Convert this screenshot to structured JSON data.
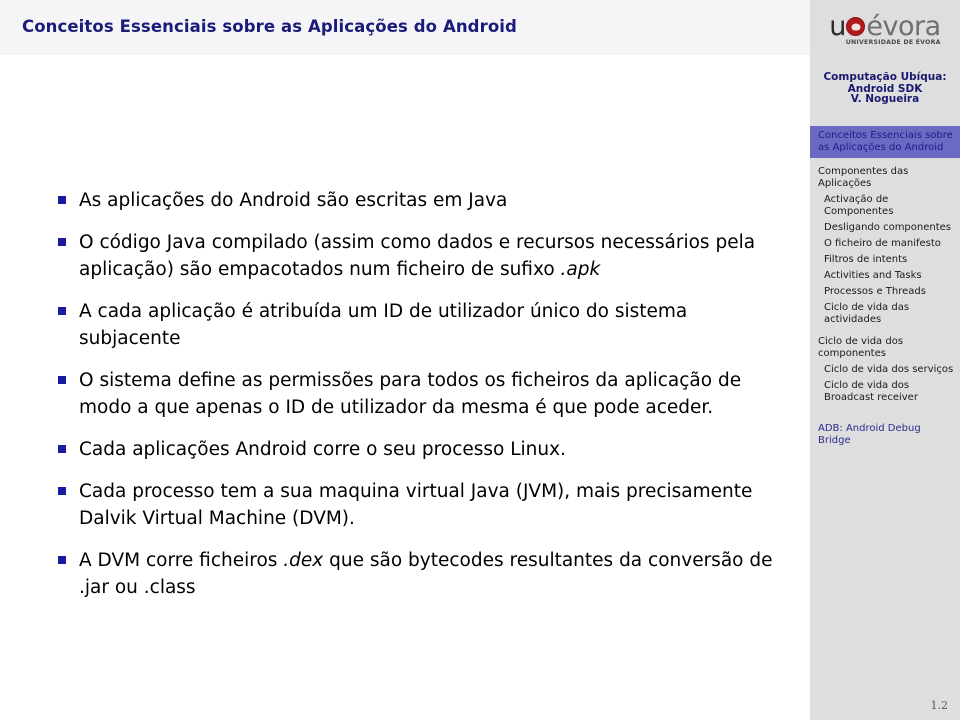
{
  "header": {
    "title": "Conceitos Essenciais sobre as Aplicações do Android"
  },
  "logo": {
    "u": "u",
    "seal": "evora-seal-icon",
    "wordmark": "évora",
    "subtitle": "UNIVERSIDADE DE ÉVORA"
  },
  "sidebar": {
    "course": {
      "line1": "Computação Ubíqua:",
      "line2": "Android SDK",
      "author": "V. Nogueira"
    },
    "toc": [
      {
        "label": "Conceitos Essenciais sobre as Aplicações do Android",
        "level": 1,
        "state": "current"
      },
      {
        "label": "Componentes das Aplicações",
        "level": 1,
        "state": "normal"
      },
      {
        "label": "Activação de Componentes",
        "level": 2,
        "state": "normal"
      },
      {
        "label": "Desligando componentes",
        "level": 2,
        "state": "normal"
      },
      {
        "label": "O ficheiro de manifesto",
        "level": 2,
        "state": "normal"
      },
      {
        "label": "Filtros de intents",
        "level": 2,
        "state": "normal"
      },
      {
        "label": "Activities and Tasks",
        "level": 2,
        "state": "normal"
      },
      {
        "label": "Processos e Threads",
        "level": 2,
        "state": "normal"
      },
      {
        "label": "Ciclo de vida das actividades",
        "level": 2,
        "state": "normal"
      },
      {
        "label": "Ciclo de vida dos componentes",
        "level": 1,
        "state": "normal"
      },
      {
        "label": "Ciclo de vida dos serviços",
        "level": 2,
        "state": "normal"
      },
      {
        "label": "Ciclo de vida dos Broadcast receiver",
        "level": 2,
        "state": "normal"
      },
      {
        "label": "ADB: Android Debug Bridge",
        "level": 1,
        "state": "link"
      }
    ]
  },
  "main": {
    "bullets": [
      {
        "html": "As aplicações do Android são escritas em Java"
      },
      {
        "html": "O código Java compilado (assim como dados e recursos necessários pela aplicação) são empacotados num ficheiro de sufixo <em>.apk</em>"
      },
      {
        "html": "A cada aplicação é atribuída um ID de utilizador único do sistema subjacente"
      },
      {
        "html": "O sistema define as permissões para todos os ficheiros da aplicação de modo a que apenas o ID de utilizador da mesma é que pode aceder."
      },
      {
        "html": "Cada aplicações Android corre o seu processo Linux."
      },
      {
        "html": "Cada processo tem a sua maquina virtual Java (JVM), mais precisamente Dalvik Virtual Machine (DVM)."
      },
      {
        "html": "A DVM corre ficheiros <em>.dex</em> que são bytecodes resultantes da conversão de .jar ou .class"
      }
    ]
  },
  "footer": {
    "page_number": "1.2"
  },
  "colors": {
    "title_blue": "#1b1b7a",
    "bullet_marker": "#1a1aa0",
    "sidebar_bg": "#dedede",
    "toc_highlight": "#6a6ac2",
    "header_bg": "#f5f5f7",
    "seal_red": "#b01a1a"
  }
}
